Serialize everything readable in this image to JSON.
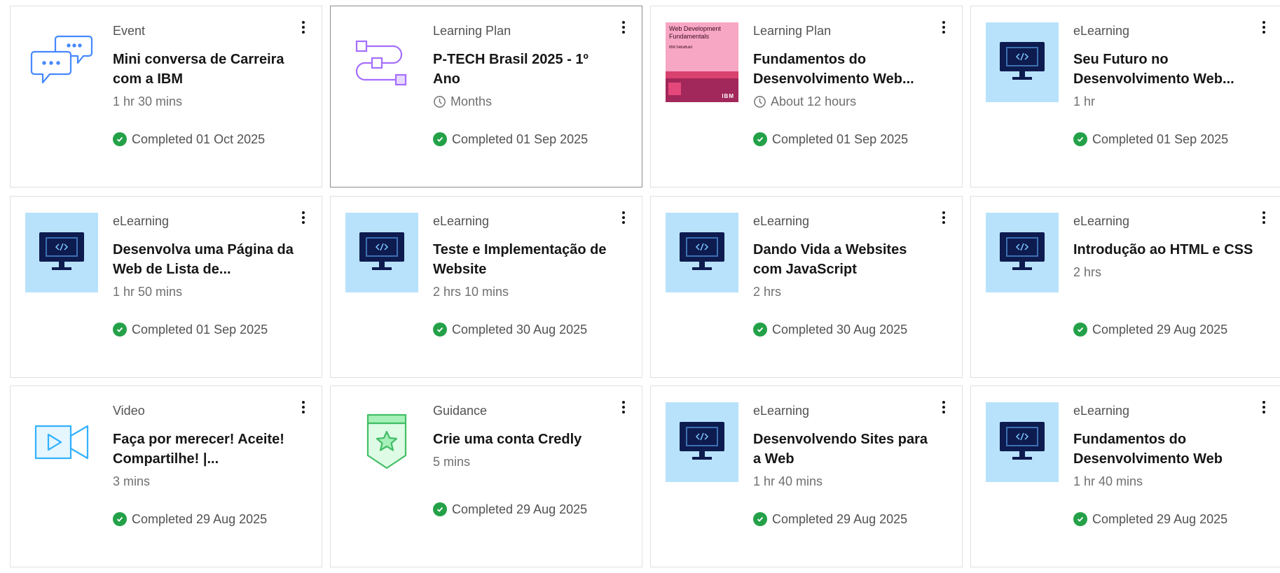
{
  "status_color": "#24a148",
  "icon_colors": {
    "elearning_bg": "#b8e2fb",
    "monitor": "#0d1b4f",
    "chat": "#4589ff",
    "plan": "#a56eff",
    "guidance": "#42be65",
    "video": "#33b1ff"
  },
  "cards": [
    {
      "type": "Event",
      "title": "Mini conversa de Carreira com a IBM",
      "duration": "1 hr 30 mins",
      "status": "Completed 01 Oct 2025",
      "icon": "chat-bubbles-icon"
    },
    {
      "type": "Learning Plan",
      "title": "P-TECH Brasil 2025 - 1º Ano",
      "duration": "Months",
      "status": "Completed 01 Sep 2025",
      "icon": "learning-plan-icon"
    },
    {
      "type": "Learning Plan",
      "title": "Fundamentos do Desenvolvimento Web...",
      "duration": "About 12 hours",
      "status": "Completed 01 Sep 2025",
      "icon": "book-cover-image",
      "cover_title": "Web Development Fundamentals",
      "cover_sub": "IBM SkillsBuild",
      "cover_logo": "IBM"
    },
    {
      "type": "eLearning",
      "title": "Seu Futuro no Desenvolvimento Web...",
      "duration": "1 hr",
      "status": "Completed 01 Sep 2025",
      "icon": "code-monitor-icon"
    },
    {
      "type": "eLearning",
      "title": "Desenvolva uma Página da Web de Lista de...",
      "duration": "1 hr 50 mins",
      "status": "Completed 01 Sep 2025",
      "icon": "code-monitor-icon"
    },
    {
      "type": "eLearning",
      "title": "Teste e Implementação de Website",
      "duration": "2 hrs 10 mins",
      "status": "Completed 30 Aug 2025",
      "icon": "code-monitor-icon"
    },
    {
      "type": "eLearning",
      "title": "Dando Vida a Websites com JavaScript",
      "duration": "2 hrs",
      "status": "Completed 30 Aug 2025",
      "icon": "code-monitor-icon"
    },
    {
      "type": "eLearning",
      "title": "Introdução ao HTML e CSS",
      "duration": "2 hrs",
      "status": "Completed 29 Aug 2025",
      "icon": "code-monitor-icon"
    },
    {
      "type": "Video",
      "title": "Faça por merecer! Aceite! Compartilhe! |...",
      "duration": "3 mins",
      "status": "Completed 29 Aug 2025",
      "icon": "video-icon"
    },
    {
      "type": "Guidance",
      "title": "Crie uma conta Credly",
      "duration": "5 mins",
      "status": "Completed 29 Aug 2025",
      "icon": "badge-star-icon"
    },
    {
      "type": "eLearning",
      "title": "Desenvolvendo Sites para a Web",
      "duration": "1 hr 40 mins",
      "status": "Completed 29 Aug 2025",
      "icon": "code-monitor-icon"
    },
    {
      "type": "eLearning",
      "title": "Fundamentos do Desenvolvimento Web",
      "duration": "1 hr 40 mins",
      "status": "Completed 29 Aug 2025",
      "icon": "code-monitor-icon"
    }
  ]
}
